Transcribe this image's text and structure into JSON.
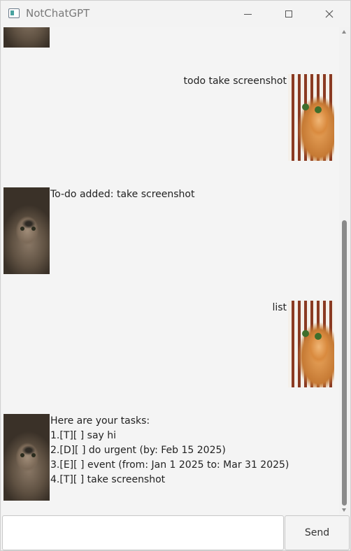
{
  "window": {
    "title": "NotChatGPT",
    "minimize_icon": "minimize-icon",
    "maximize_icon": "maximize-icon",
    "close_icon": "close-icon"
  },
  "messages": [
    {
      "sender": "bot",
      "avatar": "tabby-cat-avatar",
      "lines": []
    },
    {
      "sender": "user",
      "avatar": "ginger-cat-avatar",
      "lines": [
        "todo take screenshot"
      ]
    },
    {
      "sender": "bot",
      "avatar": "tabby-cat-avatar",
      "lines": [
        "To-do added: take screenshot"
      ]
    },
    {
      "sender": "user",
      "avatar": "ginger-cat-avatar",
      "lines": [
        "list"
      ]
    },
    {
      "sender": "bot",
      "avatar": "tabby-cat-avatar",
      "lines": [
        "Here are your tasks:",
        "1.[T][ ] say hi",
        "2.[D][ ] do urgent (by: Feb 15 2025)",
        "3.[E][ ] event (from: Jan 1 2025 to: Mar 31 2025)",
        "4.[T][ ] take screenshot"
      ]
    }
  ],
  "input": {
    "value": "",
    "placeholder": ""
  },
  "send_label": "Send"
}
